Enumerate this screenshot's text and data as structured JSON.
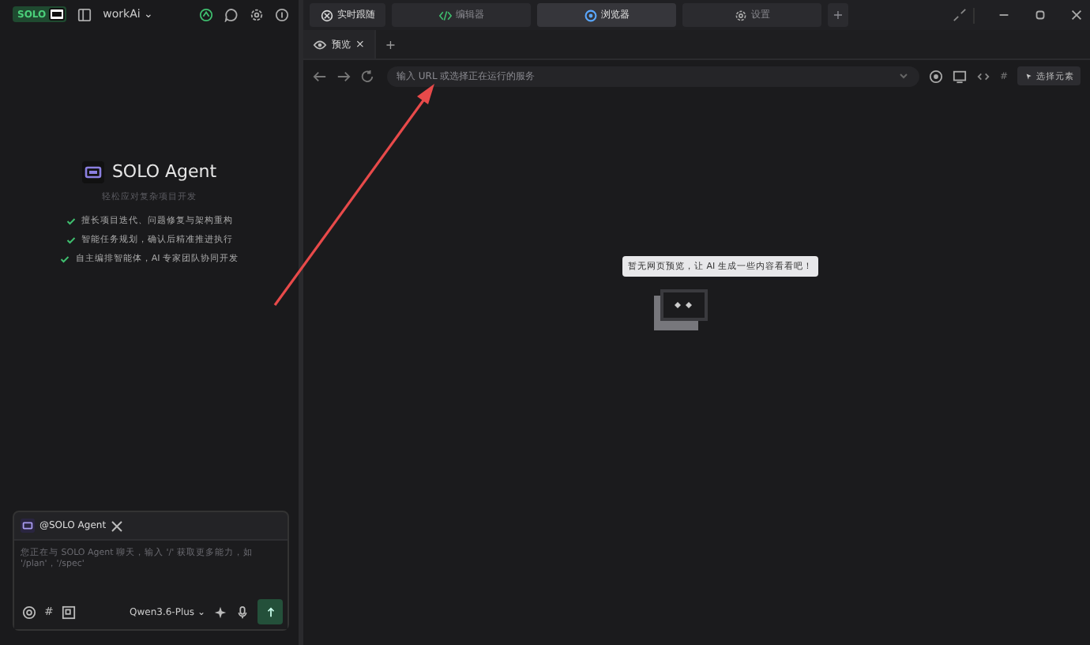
{
  "workspace": {
    "badge": "SOLO",
    "name": "workAi",
    "caret": "⌄"
  },
  "agent": {
    "title": "SOLO Agent",
    "subtitle": "轻松应对复杂项目开发",
    "features": [
      "擅长项目迭代、问题修复与架构重构",
      "智能任务规划，确认后精准推进执行",
      "自主编排智能体，AI 专家团队协同开发"
    ]
  },
  "composer": {
    "mention": "@SOLO Agent",
    "placeholder": "您正在与 SOLO Agent 聊天，输入 '/' 获取更多能力，如 '/plan'，'/spec'",
    "hash": "#",
    "model": "Qwen3.6-Plus",
    "caret": "⌄"
  },
  "tabs": [
    {
      "label": "实时跟随",
      "selected": false,
      "kind": "follow"
    },
    {
      "label": "编辑器",
      "selected": false,
      "kind": "editor"
    },
    {
      "label": "浏览器",
      "selected": true,
      "kind": "browser"
    },
    {
      "label": "设置",
      "selected": false,
      "kind": "settings"
    }
  ],
  "tab_add": "+",
  "browser_tabs": [
    {
      "label": "预览",
      "close": "×"
    }
  ],
  "browser_tab_add": "+",
  "address": {
    "placeholder": "输入 URL 或选择正在运行的服务"
  },
  "toolbar": {
    "hash": "#",
    "select_button": "选择元素"
  },
  "empty": {
    "tooltip": "暂无网页预览，让 AI 生成一些内容看看吧！"
  }
}
